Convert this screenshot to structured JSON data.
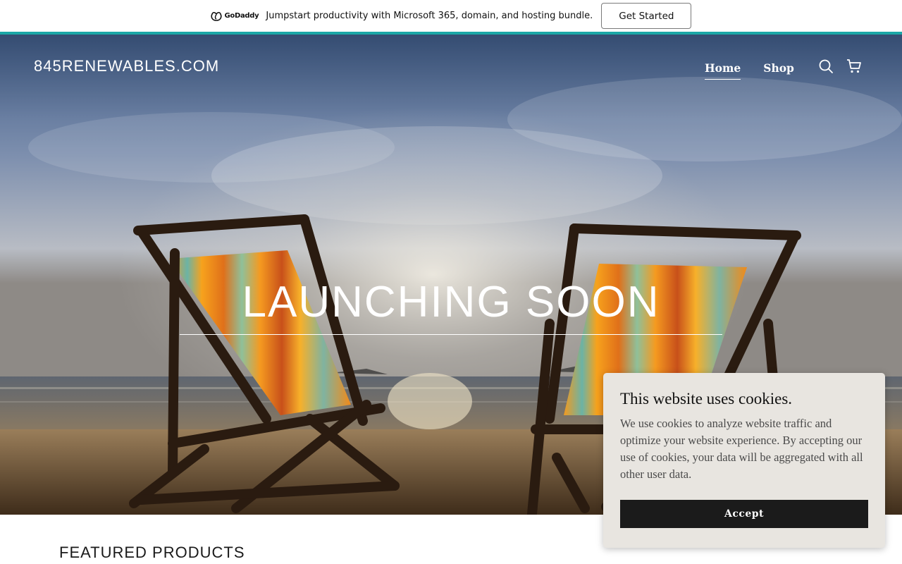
{
  "promo": {
    "logo_text": "GoDaddy",
    "message": "Jumpstart productivity with Microsoft 365, domain, and hosting bundle.",
    "cta_label": "Get Started",
    "accent_color": "#1ba7a7"
  },
  "header": {
    "site_title": "845RENEWABLES.COM",
    "nav": [
      {
        "label": "Home",
        "active": true
      },
      {
        "label": "Shop",
        "active": false
      }
    ],
    "icons": [
      "search-icon",
      "cart-icon"
    ]
  },
  "hero": {
    "heading": "LAUNCHING SOON"
  },
  "featured": {
    "heading": "FEATURED PRODUCTS"
  },
  "cookie": {
    "title": "This website uses cookies.",
    "body": "We use cookies to analyze website traffic and optimize your website experience. By accepting our use of cookies, your data will be aggregated with all other user data.",
    "accept_label": "Accept"
  }
}
